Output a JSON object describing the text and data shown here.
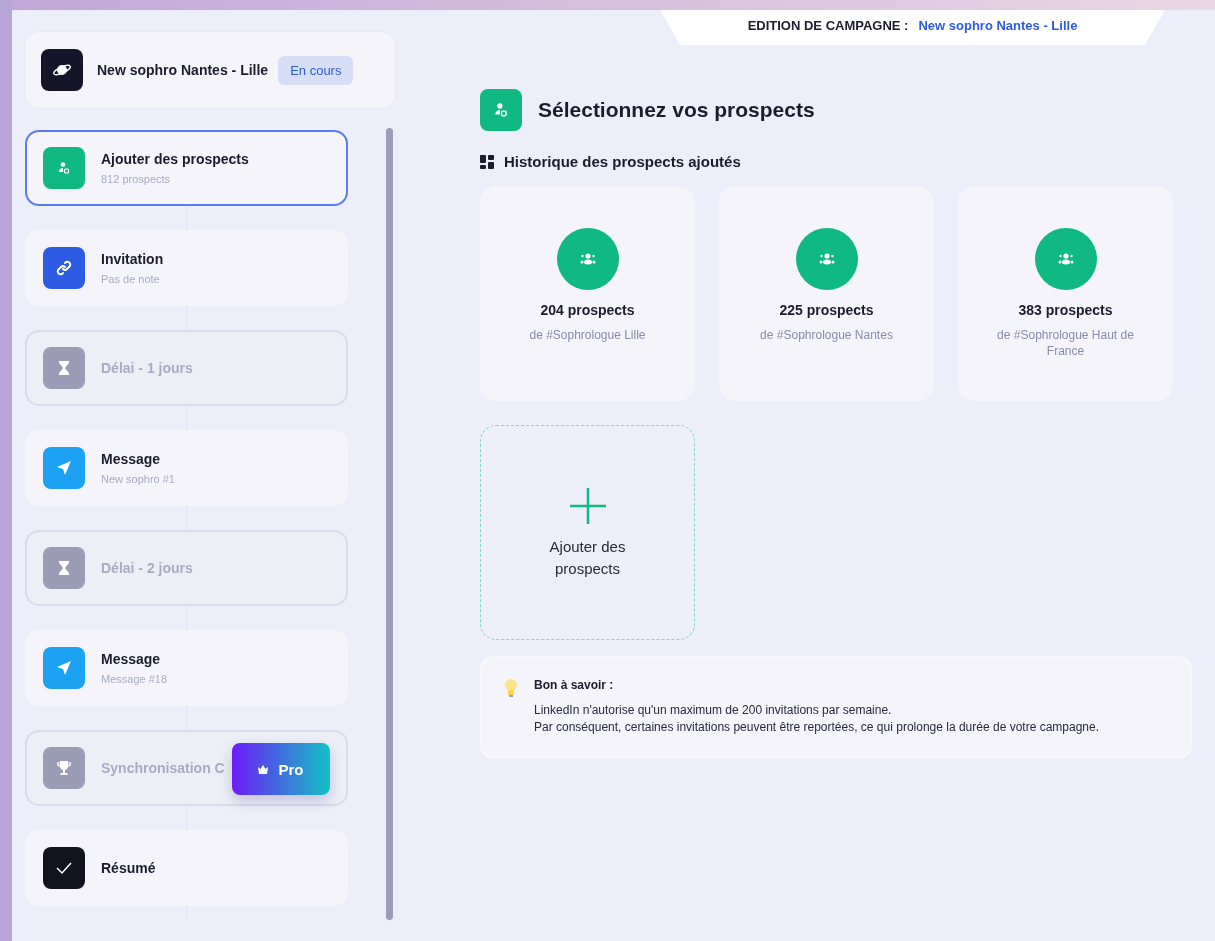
{
  "header": {
    "label": "EDITION DE CAMPAGNE :",
    "campaign": "New sophro Nantes - Lille"
  },
  "campaign_card": {
    "name": "New sophro Nantes - Lille",
    "status": "En cours"
  },
  "steps": [
    {
      "kind": "prospects",
      "title": "Ajouter des prospects",
      "subtitle": "812 prospects",
      "selected": true,
      "disabled": false
    },
    {
      "kind": "invitation",
      "title": "Invitation",
      "subtitle": "Pas de note",
      "selected": false,
      "disabled": false
    },
    {
      "kind": "delay",
      "title": "Délai - 1 jours",
      "selected": false,
      "disabled": true
    },
    {
      "kind": "message",
      "title": "Message",
      "subtitle": "New sophro #1",
      "selected": false,
      "disabled": false
    },
    {
      "kind": "delay",
      "title": "Délai - 2 jours",
      "selected": false,
      "disabled": true
    },
    {
      "kind": "message",
      "title": "Message",
      "subtitle": "Message #18",
      "selected": false,
      "disabled": false
    },
    {
      "kind": "crm",
      "title": "Synchronisation C",
      "selected": false,
      "disabled": true,
      "badge": "Pro"
    },
    {
      "kind": "summary",
      "title": "Résumé",
      "selected": false,
      "disabled": false
    }
  ],
  "main": {
    "title": "Sélectionnez vos prospects",
    "section": "Historique des prospects ajoutés",
    "lists": [
      {
        "count": "204 prospects",
        "source": "de #Sophrologue Lille"
      },
      {
        "count": "225 prospects",
        "source": "de #Sophrologue Nantes"
      },
      {
        "count": "383 prospects",
        "source": "de #Sophrologue Haut de France"
      }
    ],
    "add_button": "Ajouter des prospects",
    "tip": {
      "title": "Bon à savoir :",
      "lines": [
        "LinkedIn n'autorise qu'un maximum de 200 invitations par semaine.",
        "Par conséquent, certaines invitations peuvent être reportées, ce qui prolonge la durée de votre campagne."
      ]
    }
  }
}
